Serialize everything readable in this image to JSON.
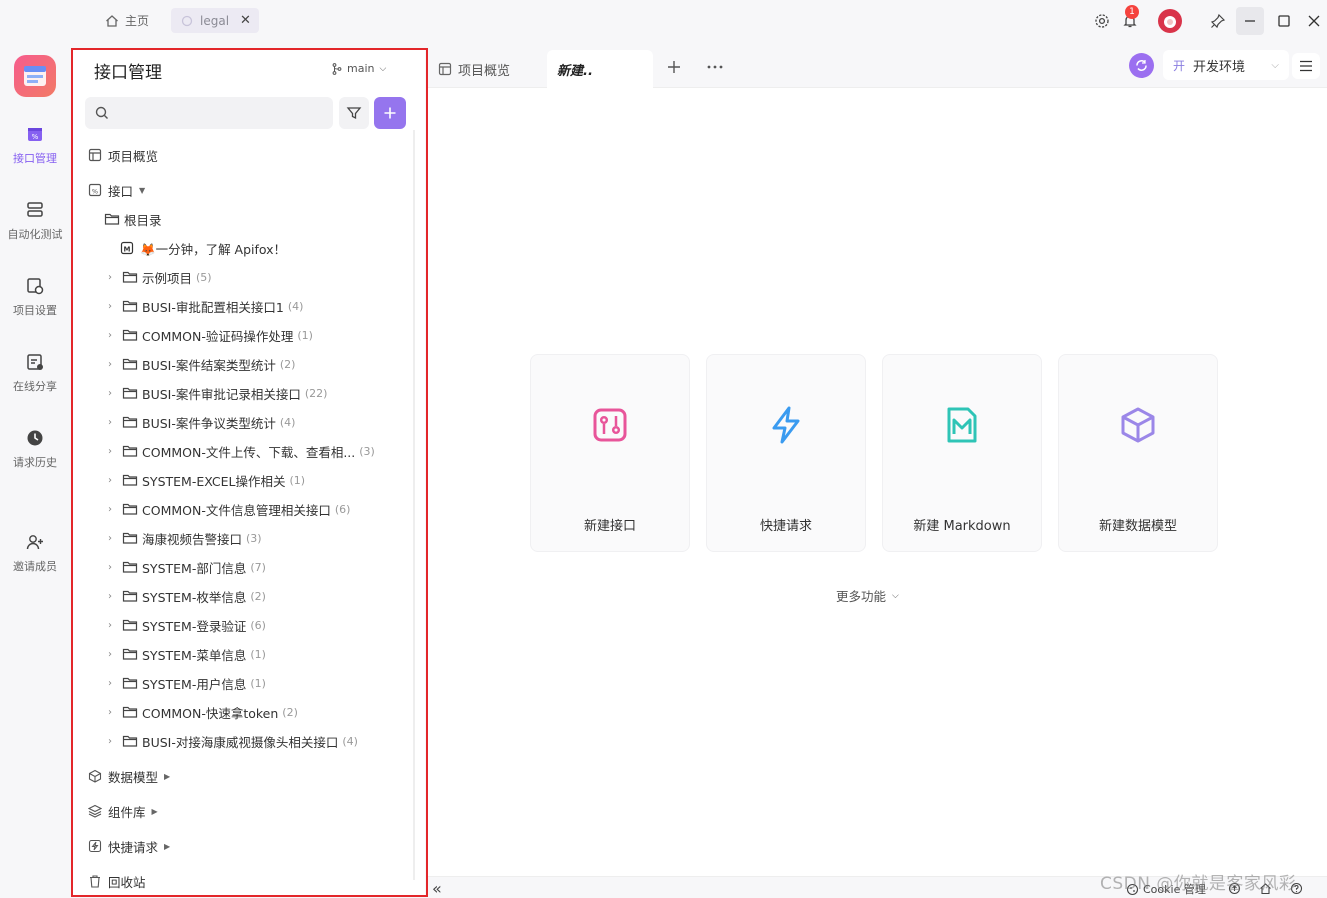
{
  "topbar": {
    "home_label": "主页",
    "project_tab_label": "legal",
    "notification_count": "1"
  },
  "rail": {
    "items": [
      {
        "label": "接口管理",
        "icon": "api-icon"
      },
      {
        "label": "自动化测试",
        "icon": "automation-icon"
      },
      {
        "label": "项目设置",
        "icon": "settings-icon"
      },
      {
        "label": "在线分享",
        "icon": "share-icon"
      },
      {
        "label": "请求历史",
        "icon": "history-icon"
      },
      {
        "label": "邀请成员",
        "icon": "invite-icon"
      }
    ]
  },
  "sidebar": {
    "title": "接口管理",
    "branch": "main",
    "search_placeholder": "",
    "overview_label": "项目概览",
    "api_label": "接口",
    "root_label": "根目录",
    "doc_label": "🦊一分钟，了解 Apifox！",
    "folders": [
      {
        "name": "示例项目",
        "count": "(5)"
      },
      {
        "name": "BUSI-审批配置相关接口1",
        "count": "(4)"
      },
      {
        "name": "COMMON-验证码操作处理",
        "count": "(1)"
      },
      {
        "name": "BUSI-案件结案类型统计",
        "count": "(2)"
      },
      {
        "name": "BUSI-案件审批记录相关接口",
        "count": "(22)"
      },
      {
        "name": "BUSI-案件争议类型统计",
        "count": "(4)"
      },
      {
        "name": "COMMON-文件上传、下载、查看相...",
        "count": "(3)"
      },
      {
        "name": "SYSTEM-EXCEL操作相关",
        "count": "(1)"
      },
      {
        "name": "COMMON-文件信息管理相关接口",
        "count": "(6)"
      },
      {
        "name": "海康视频告警接口",
        "count": "(3)"
      },
      {
        "name": "SYSTEM-部门信息",
        "count": "(7)"
      },
      {
        "name": "SYSTEM-枚举信息",
        "count": "(2)"
      },
      {
        "name": "SYSTEM-登录验证",
        "count": "(6)"
      },
      {
        "name": "SYSTEM-菜单信息",
        "count": "(1)"
      },
      {
        "name": "SYSTEM-用户信息",
        "count": "(1)"
      },
      {
        "name": "COMMON-快速拿token",
        "count": "(2)"
      },
      {
        "name": "BUSI-对接海康威视摄像头相关接口",
        "count": "(4)"
      }
    ],
    "models_label": "数据模型",
    "components_label": "组件库",
    "quick_label": "快捷请求",
    "trash_label": "回收站"
  },
  "main": {
    "tabs": [
      {
        "label": "项目概览"
      },
      {
        "label": "新建.."
      }
    ],
    "env_icon": "开",
    "env_label": "开发环境",
    "cards": [
      {
        "label": "新建接口",
        "color": "#e8559a"
      },
      {
        "label": "快捷请求",
        "color": "#3a9bf0"
      },
      {
        "label": "新建 Markdown",
        "color": "#2ec4b6"
      },
      {
        "label": "新建数据模型",
        "color": "#9b87e8"
      }
    ],
    "more_label": "更多功能"
  },
  "status": {
    "cookie_label": "Cookie 管理",
    "collapse_icon": "«"
  },
  "watermark": "CSDN @你就是客家风彩"
}
